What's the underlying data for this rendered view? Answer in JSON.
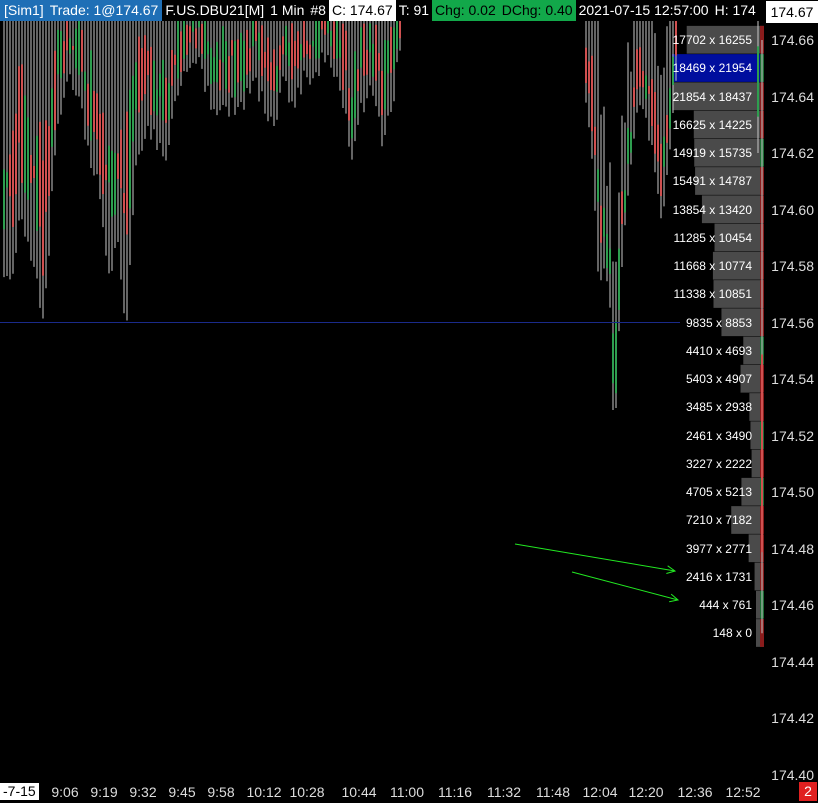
{
  "header": {
    "account": "[Sim1]",
    "trade": "Trade: 1@174.67",
    "instrument": "F.US.DBU21[M]",
    "interval": "1 Min",
    "bar_number": "#8",
    "close": "C: 174.67",
    "ticks": "T: 91",
    "chg": "Chg: 0.02",
    "dchg": "DChg: 0.40",
    "datetime": "2021-07-15 12:57:00",
    "high_partial": "H: 174"
  },
  "last_price": "174.67",
  "price_axis": {
    "labels": [
      "174.66",
      "174.64",
      "174.62",
      "174.60",
      "174.58",
      "174.56",
      "174.54",
      "174.52",
      "174.50",
      "174.48",
      "174.46",
      "174.44",
      "174.42",
      "174.40"
    ]
  },
  "time_axis": {
    "date": "-7-15",
    "labels": [
      "9:06",
      "9:19",
      "9:32",
      "9:45",
      "9:58",
      "10:12",
      "10:28",
      "10:44",
      "11:00",
      "11:16",
      "11:32",
      "11:48",
      "12:04",
      "12:20",
      "12:36",
      "12:52"
    ],
    "badge": "2"
  },
  "colors": {
    "background": "#000000",
    "header_blue": "#1f6fb6",
    "header_green": "#12a84a",
    "up_bar": "#2e9e4f",
    "down_bar": "#d05050",
    "wick": "#c8c8c8",
    "volume_bg": "#4a4a4a",
    "highlight_row": "#000e9e",
    "arrow": "#22e822",
    "price_line": "#1a2a8a"
  },
  "chart_data": {
    "type": "candlestick",
    "price_ylim": [
      174.4,
      174.67
    ],
    "volume_profile": [
      {
        "price": 174.66,
        "bid_ask": "17702 x 16255"
      },
      {
        "price": 174.65,
        "bid_ask": "18469 x 21954",
        "highlight": true
      },
      {
        "price": 174.64,
        "bid_ask": "21854 x 18437"
      },
      {
        "price": 174.63,
        "bid_ask": "16625 x 14225"
      },
      {
        "price": 174.62,
        "bid_ask": "14919 x 15735"
      },
      {
        "price": 174.61,
        "bid_ask": "15491 x 14787"
      },
      {
        "price": 174.6,
        "bid_ask": "13854 x 13420"
      },
      {
        "price": 174.59,
        "bid_ask": "11285 x 10454"
      },
      {
        "price": 174.58,
        "bid_ask": "11668 x 10774"
      },
      {
        "price": 174.57,
        "bid_ask": "11338 x 10851"
      },
      {
        "price": 174.56,
        "bid_ask": "9835 x 8853"
      },
      {
        "price": 174.55,
        "bid_ask": "4410 x 4693"
      },
      {
        "price": 174.54,
        "bid_ask": "5403 x 4907"
      },
      {
        "price": 174.53,
        "bid_ask": "3485 x 2938"
      },
      {
        "price": 174.52,
        "bid_ask": "2461 x 3490"
      },
      {
        "price": 174.51,
        "bid_ask": "3227 x 2222"
      },
      {
        "price": 174.5,
        "bid_ask": "4705 x 5213"
      },
      {
        "price": 174.49,
        "bid_ask": "7210 x 7182"
      },
      {
        "price": 174.48,
        "bid_ask": "3977 x 2771"
      },
      {
        "price": 174.47,
        "bid_ask": "2416 x 1731"
      },
      {
        "price": 174.46,
        "bid_ask": "444 x 761"
      },
      {
        "price": 174.45,
        "bid_ask": "148 x 0"
      }
    ],
    "horizontal_line_price": 174.56
  }
}
